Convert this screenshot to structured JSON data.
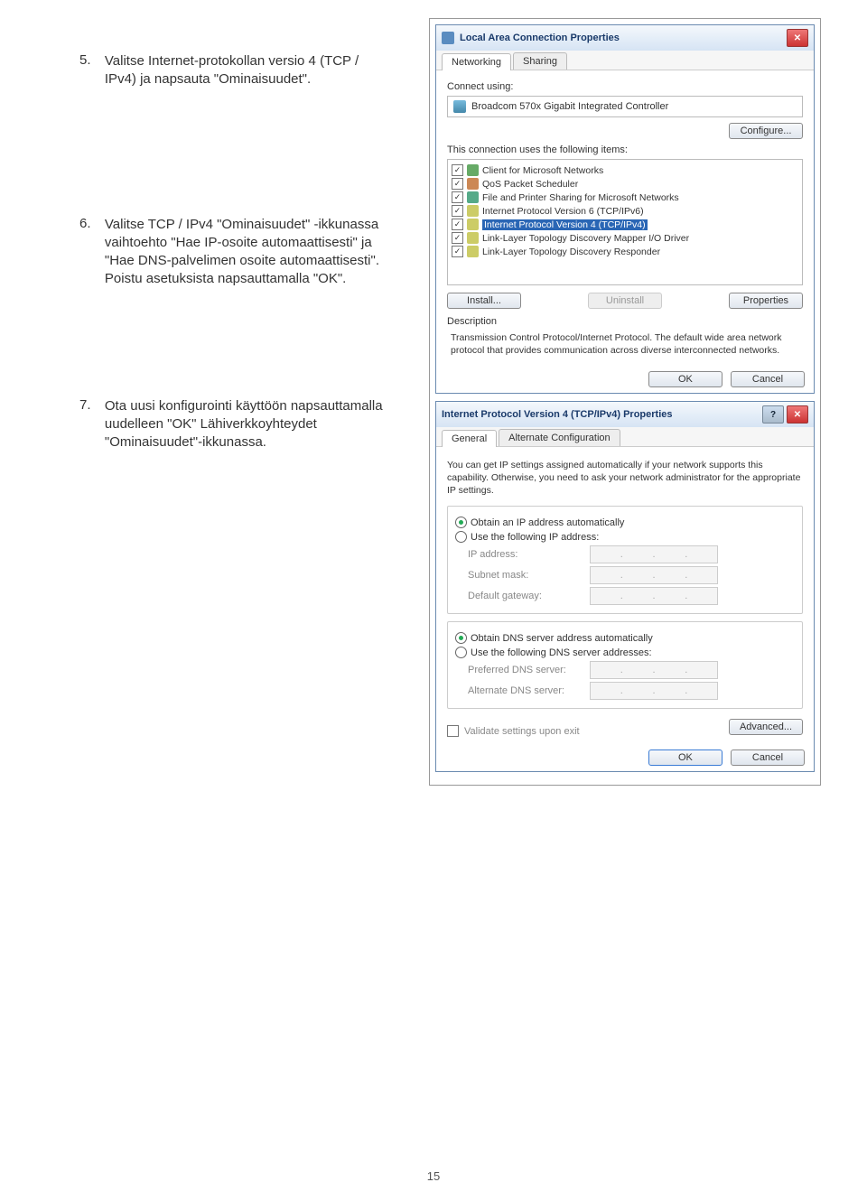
{
  "page_number": "15",
  "steps": [
    {
      "num": "5.",
      "text": "Valitse Internet-protokollan versio 4 (TCP / IPv4) ja napsauta \"Ominaisuudet\"."
    },
    {
      "num": "6.",
      "text": "Valitse TCP / IPv4 \"Ominaisuudet\" -ikkunassa vaihtoehto \"Hae IP-osoite automaattisesti\" ja \"Hae DNS-palvelimen osoite automaattisesti\". Poistu asetuksista napsauttamalla \"OK\"."
    },
    {
      "num": "7.",
      "text": "Ota uusi konfigurointi käyttöön napsauttamalla uudelleen \"OK\" Lähiverkkoyhteydet \"Ominaisuudet\"-ikkunassa."
    }
  ],
  "dialog1": {
    "title": "Local Area Connection Properties",
    "close": "✕",
    "tabs": [
      "Networking",
      "Sharing"
    ],
    "connect_using_label": "Connect using:",
    "adapter": "Broadcom 570x Gigabit Integrated Controller",
    "configure_btn": "Configure...",
    "items_label": "This connection uses the following items:",
    "items": [
      "Client for Microsoft Networks",
      "QoS Packet Scheduler",
      "File and Printer Sharing for Microsoft Networks",
      "Internet Protocol Version 6 (TCP/IPv6)",
      "Internet Protocol Version 4 (TCP/IPv4)",
      "Link-Layer Topology Discovery Mapper I/O Driver",
      "Link-Layer Topology Discovery Responder"
    ],
    "install_btn": "Install...",
    "uninstall_btn": "Uninstall",
    "properties_btn": "Properties",
    "desc_label": "Description",
    "desc_text": "Transmission Control Protocol/Internet Protocol. The default wide area network protocol that provides communication across diverse interconnected networks.",
    "ok_btn": "OK",
    "cancel_btn": "Cancel"
  },
  "dialog2": {
    "title": "Internet Protocol Version 4 (TCP/IPv4) Properties",
    "help": "?",
    "close": "✕",
    "tabs": [
      "General",
      "Alternate Configuration"
    ],
    "intro": "You can get IP settings assigned automatically if your network supports this capability. Otherwise, you need to ask your network administrator for the appropriate IP settings.",
    "r_auto_ip": "Obtain an IP address automatically",
    "r_use_ip": "Use the following IP address:",
    "ip_label": "IP address:",
    "mask_label": "Subnet mask:",
    "gw_label": "Default gateway:",
    "r_auto_dns": "Obtain DNS server address automatically",
    "r_use_dns": "Use the following DNS server addresses:",
    "pref_dns_label": "Preferred DNS server:",
    "alt_dns_label": "Alternate DNS server:",
    "validate_label": "Validate settings upon exit",
    "advanced_btn": "Advanced...",
    "ok_btn": "OK",
    "cancel_btn": "Cancel"
  }
}
